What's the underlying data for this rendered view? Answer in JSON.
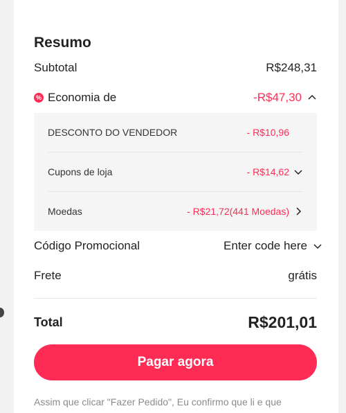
{
  "summary": {
    "title": "Resumo",
    "subtotal_label": "Subtotal",
    "subtotal_value": "R$248,31",
    "savings_label": "Economia de",
    "savings_badge": "%",
    "savings_value": "-R$47,30",
    "discounts": [
      {
        "label": "DESCONTO DO VENDEDOR",
        "value": "- R$10,96"
      },
      {
        "label": "Cupons de loja",
        "value": "- R$14,62"
      },
      {
        "label": "Moedas",
        "value": "- R$21,72(441 Moedas)"
      }
    ],
    "promo_label": "Código Promocional",
    "promo_placeholder": "Enter code here",
    "shipping_label": "Frete",
    "shipping_value": "grátis",
    "total_label": "Total",
    "total_value": "R$201,01",
    "pay_button": "Pagar agora",
    "disclaimer": "Assim que clicar \"Fazer Pedido\", Eu confirmo que li e que"
  },
  "colors": {
    "accent": "#fe2c55",
    "panel_bg": "#f5f5f5"
  },
  "icons": [
    "discount-badge-icon",
    "chevron-up-icon",
    "chevron-down-icon",
    "chevron-right-icon"
  ]
}
